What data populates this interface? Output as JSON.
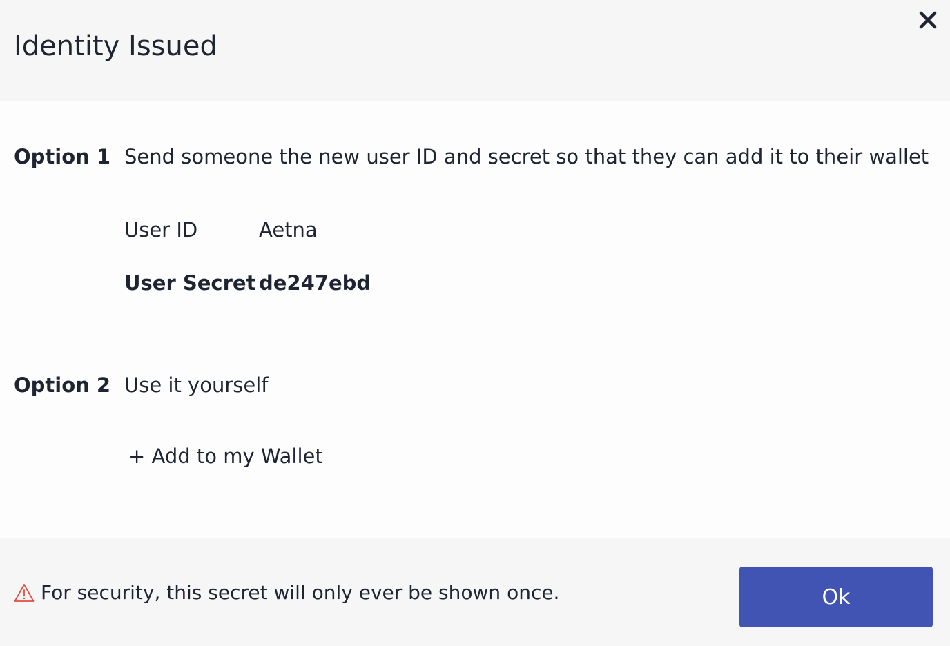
{
  "dialog": {
    "title": "Identity Issued",
    "close_icon": "close-icon"
  },
  "option1": {
    "label": "Option 1",
    "description": "Send someone the new user ID and secret so that they can add it to their wallet",
    "user_id_label": "User ID",
    "user_id_value": "Aetna",
    "user_secret_label": "User Secret",
    "user_secret_value": "de247ebd"
  },
  "option2": {
    "label": "Option 2",
    "description": "Use it yourself",
    "add_wallet_label": "+ Add to my Wallet"
  },
  "footer": {
    "warning_icon": "warning-icon",
    "warning_text": "For security, this secret will only ever be shown once.",
    "ok_label": "Ok"
  },
  "colors": {
    "primary_button": "#4153b3",
    "warning_icon": "#e74c3c",
    "text": "#1f2433",
    "header_bg": "#f6f6f6"
  }
}
